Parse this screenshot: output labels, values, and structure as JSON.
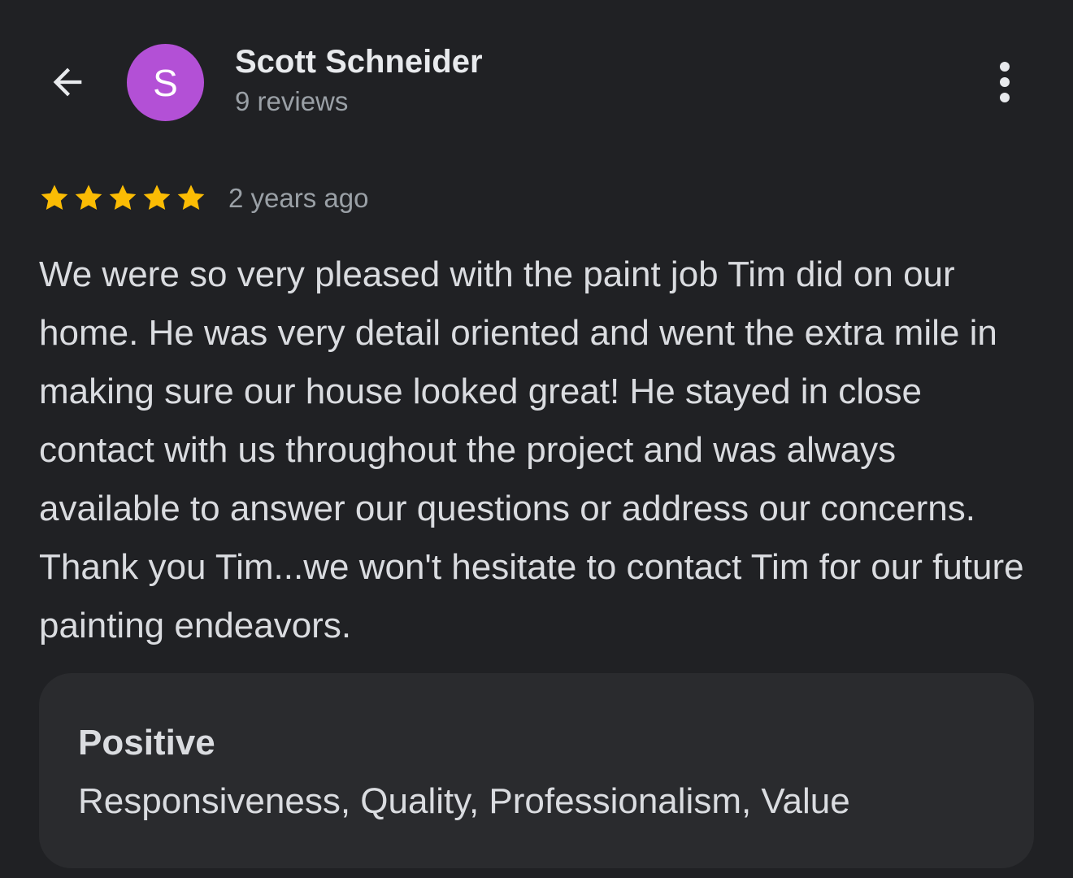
{
  "header": {
    "back_icon": "arrow-left-icon",
    "avatar": {
      "initial": "S",
      "color": "#b350d6"
    },
    "reviewer_name": "Scott Schneider",
    "review_count": "9 reviews",
    "more_icon": "more-vertical-icon"
  },
  "review": {
    "rating": 5,
    "rating_max": 5,
    "star_color": "#fbbc04",
    "time_ago": "2 years ago",
    "text": "We were so very pleased with the paint job Tim did on our home. He was very detail oriented and went the extra mile in making sure our house looked great! He stayed in close contact with us throughout the project and was always available to answer our questions or address our concerns. Thank you Tim...we won't hesitate to contact Tim for our future painting endeavors."
  },
  "highlights": {
    "title": "Positive",
    "values": "Responsiveness, Quality, Professionalism, Value"
  }
}
